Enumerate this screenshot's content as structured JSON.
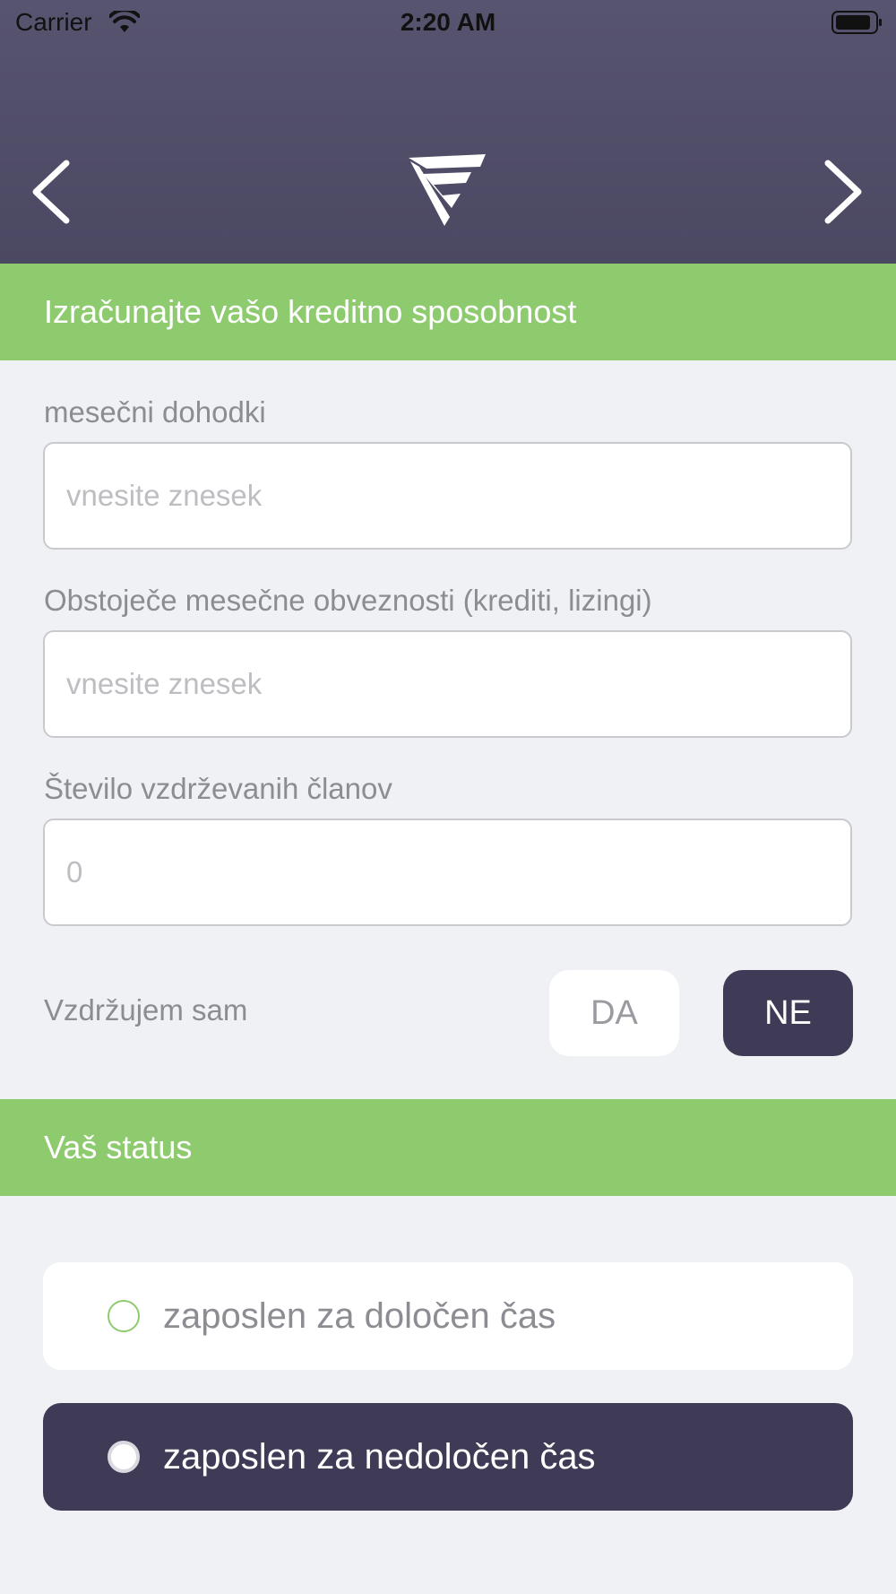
{
  "status_bar": {
    "carrier": "Carrier",
    "time": "2:20 AM"
  },
  "nav": {
    "back_icon": "chevron-left-icon",
    "next_icon": "chevron-right-icon",
    "logo_icon": "brand-logo-icon"
  },
  "credit_section": {
    "title": "Izračunajte vašo kreditno sposobnost",
    "fields": [
      {
        "label": "mesečni dohodki",
        "placeholder": "vnesite znesek",
        "value": ""
      },
      {
        "label": "Obstoječe mesečne obveznosti (krediti, lizingi)",
        "placeholder": "vnesite znesek",
        "value": ""
      },
      {
        "label": "Število vzdrževanih članov",
        "placeholder": "0",
        "value": ""
      }
    ],
    "self_support": {
      "label": "Vzdržujem sam",
      "options": [
        "DA",
        "NE"
      ],
      "selected": "NE"
    }
  },
  "status_section": {
    "title": "Vaš status",
    "options": [
      {
        "label": "zaposlen za določen čas",
        "selected": false
      },
      {
        "label": "zaposlen za nedoločen čas",
        "selected": true
      }
    ]
  },
  "colors": {
    "header": "#504d67",
    "accent_green": "#8ecb6f",
    "selected_dark": "#3f3b56",
    "background": "#f0f1f4"
  }
}
